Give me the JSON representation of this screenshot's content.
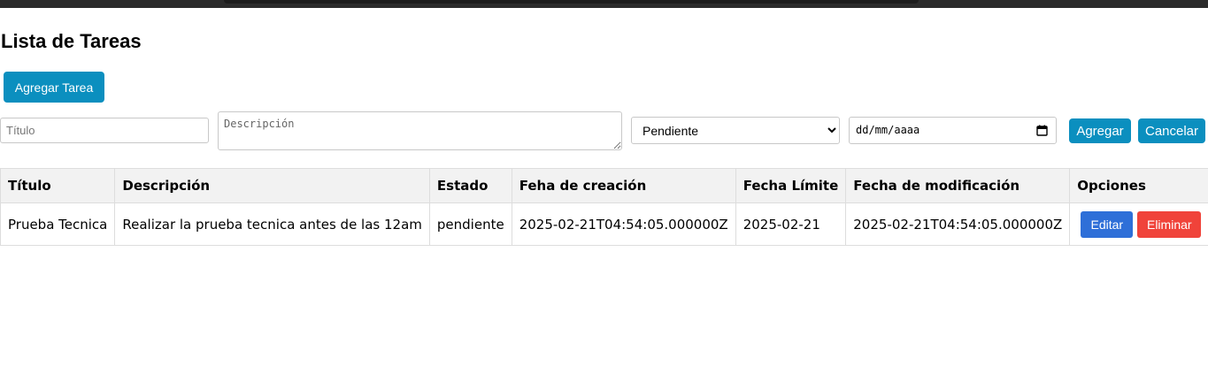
{
  "header": {
    "title": "Lista de Tareas"
  },
  "toolbar": {
    "add_task_label": "Agregar Tarea"
  },
  "form": {
    "title_placeholder": "Título",
    "title_value": "",
    "description_placeholder": "Descripción",
    "description_value": "",
    "status_selected": "Pendiente",
    "date_placeholder": "dd/mm/aaaa",
    "submit_label": "Agregar",
    "cancel_label": "Cancelar"
  },
  "table": {
    "columns": [
      "Título",
      "Descripción",
      "Estado",
      "Feha de creación",
      "Fecha Límite",
      "Fecha de modificación",
      "Opciones"
    ],
    "rows": [
      {
        "title": "Prueba Tecnica",
        "description": "Realizar la prueba tecnica antes de las 12am",
        "status": "pendiente",
        "created": "2025-02-21T04:54:05.000000Z",
        "due": "2025-02-21",
        "modified": "2025-02-21T04:54:05.000000Z",
        "edit_label": "Editar",
        "delete_label": "Eliminar"
      }
    ]
  },
  "colors": {
    "primary": "#0b8fbf",
    "edit": "#2e6fd8",
    "delete": "#f0433a",
    "header_bg": "#f2f2f2"
  }
}
